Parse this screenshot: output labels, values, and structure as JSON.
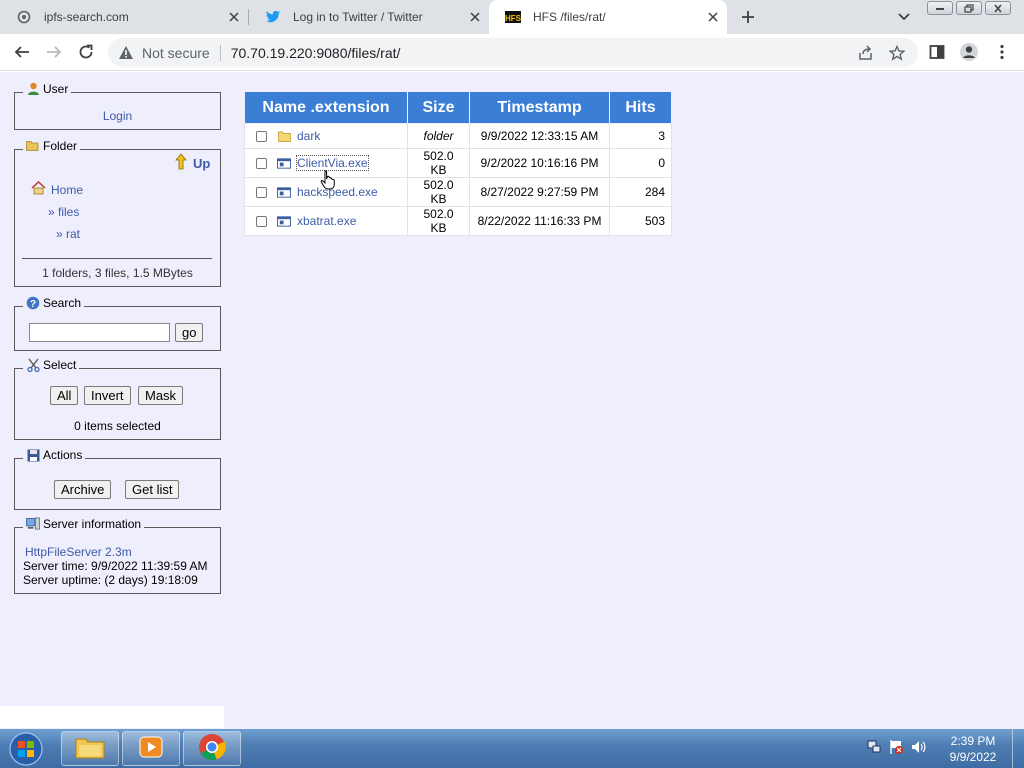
{
  "browser": {
    "tabs": [
      {
        "title": "ipfs-search.com",
        "icon": "globe-icon"
      },
      {
        "title": "Log in to Twitter / Twitter",
        "icon": "twitter-icon"
      },
      {
        "title": "HFS /files/rat/",
        "icon": "hfs-icon"
      }
    ],
    "address": {
      "security_text": "Not secure",
      "url": "70.70.19.220:9080/files/rat/"
    }
  },
  "sidebar": {
    "user": {
      "title": "User",
      "login": "Login"
    },
    "folder": {
      "title": "Folder",
      "up": "Up",
      "crumbs": [
        "Home",
        "» files",
        "» rat"
      ],
      "summary": "1 folders, 3 files, 1.5 MBytes"
    },
    "search": {
      "title": "Search",
      "value": "",
      "go": "go"
    },
    "select": {
      "title": "Select",
      "all": "All",
      "invert": "Invert",
      "mask": "Mask",
      "status": "0 items selected"
    },
    "actions": {
      "title": "Actions",
      "archive": "Archive",
      "get_list": "Get list"
    },
    "server": {
      "title": "Server information",
      "software": "HttpFileServer 2.3m",
      "time": "Server time: 9/9/2022 11:39:59 AM",
      "uptime": "Server uptime: (2 days) 19:18:09"
    }
  },
  "files": {
    "headers": [
      "Name .extension",
      "Size",
      "Timestamp",
      "Hits"
    ],
    "rows": [
      {
        "name": "dark",
        "size": "folder",
        "timestamp": "9/9/2022 12:33:15 AM",
        "hits": "3",
        "type": "folder"
      },
      {
        "name": "ClientVia.exe",
        "size": "502.0 KB",
        "timestamp": "9/2/2022 10:16:16 PM",
        "hits": "0",
        "type": "exe"
      },
      {
        "name": "hackspeed.exe",
        "size": "502.0 KB",
        "timestamp": "8/27/2022 9:27:59 PM",
        "hits": "284",
        "type": "exe"
      },
      {
        "name": "xbatrat.exe",
        "size": "502.0 KB",
        "timestamp": "8/22/2022 11:16:33 PM",
        "hits": "503",
        "type": "exe"
      }
    ]
  },
  "taskbar": {
    "apps": [
      "explorer-icon",
      "media-player-icon",
      "chrome-icon"
    ],
    "time": "2:39 PM",
    "date": "9/9/2022"
  },
  "colors": {
    "page_bg": "#eeeefc",
    "header_bg": "#3a7fd5",
    "link": "#3d5ba8"
  }
}
